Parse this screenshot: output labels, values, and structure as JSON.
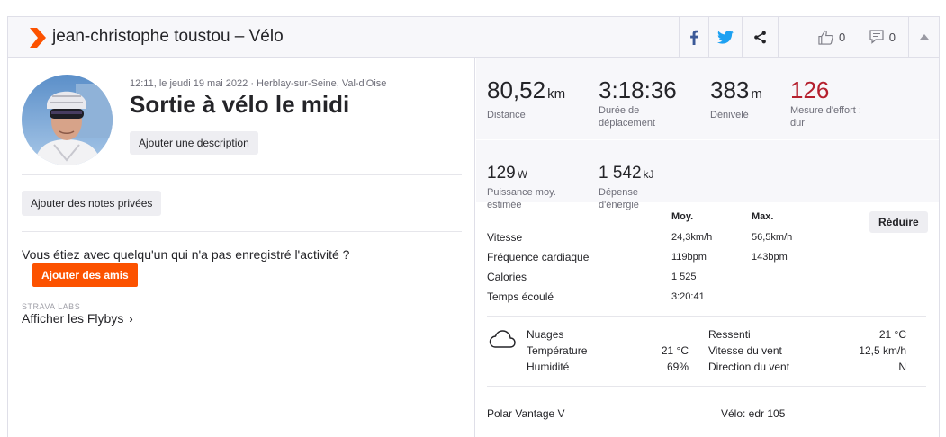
{
  "header": {
    "title": "jean-christophe toustou – Vélo",
    "kudos_count": "0",
    "comments_count": "0",
    "colors": {
      "brand": "#fc5200",
      "facebook": "#3b5998",
      "twitter": "#1da1f2"
    }
  },
  "activity": {
    "meta": "12:11, le jeudi 19 mai 2022 · Herblay-sur-Seine, Val-d'Oise",
    "title": "Sortie à vélo le midi",
    "add_description": "Ajouter une description",
    "add_private_notes": "Ajouter des notes privées",
    "question": "Vous étiez avec quelqu'un qui n'a pas enregistré l'activité ?",
    "add_friends": "Ajouter des amis",
    "labs": "STRAVA LABS",
    "flybys": "Afficher les Flybys"
  },
  "stats": {
    "distance": {
      "value": "80,52",
      "unit": "km",
      "label": "Distance"
    },
    "moving_time": {
      "value": "3:18:36",
      "label_line1": "Durée de",
      "label_line2": "déplacement"
    },
    "elevation": {
      "value": "383",
      "unit": "m",
      "label": "Dénivelé"
    },
    "effort": {
      "value": "126",
      "label_line1": "Mesure d'effort :",
      "label_line2": "dur"
    },
    "power": {
      "value": "129",
      "unit": "W",
      "label_line1": "Puissance moy.",
      "label_line2": "estimée"
    },
    "energy": {
      "value": "1 542",
      "unit": "kJ",
      "label_line1": "Dépense",
      "label_line2": "d'énergie"
    }
  },
  "table": {
    "col_avg": "Moy.",
    "col_max": "Max.",
    "reduce_button": "Réduire",
    "rows": [
      {
        "label": "Vitesse",
        "avg": "24,3km/h",
        "max": "56,5km/h"
      },
      {
        "label": "Fréquence cardiaque",
        "avg": "119bpm",
        "max": "143bpm"
      },
      {
        "label": "Calories",
        "avg": "1 525",
        "max": ""
      },
      {
        "label": "Temps écoulé",
        "avg": "3:20:41",
        "max": ""
      }
    ]
  },
  "weather": {
    "condition": "Nuages",
    "temp_label": "Température",
    "temp_value": "21 °C",
    "humidity_label": "Humidité",
    "humidity_value": "69%",
    "feels_label": "Ressenti",
    "feels_value": "21 °C",
    "wind_speed_label": "Vitesse du vent",
    "wind_speed_value": "12,5 km/h",
    "wind_dir_label": "Direction du vent",
    "wind_dir_value": "N"
  },
  "footer": {
    "device": "Polar Vantage V",
    "bike": "Vélo: edr 105"
  }
}
